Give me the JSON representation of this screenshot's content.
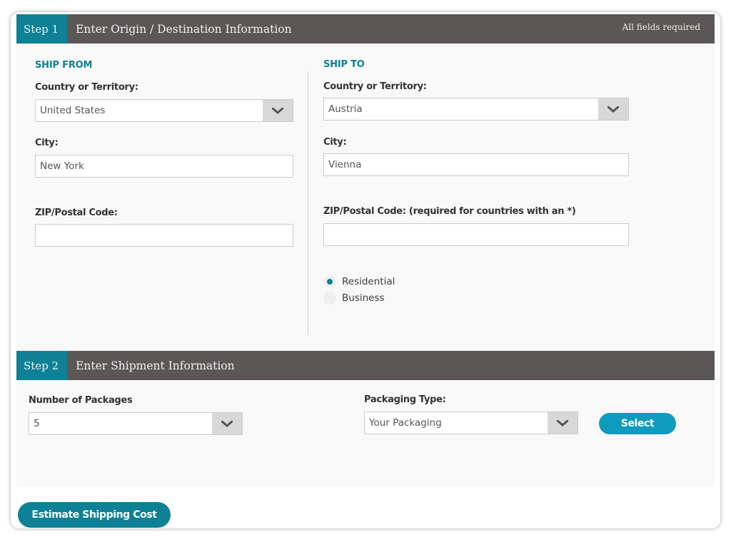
{
  "step1": {
    "tag": "Step 1",
    "title": "Enter Origin / Destination Information",
    "note": "All fields required",
    "ship_from": {
      "title": "SHIP FROM",
      "country_label": "Country or Territory:",
      "country_value": "United States",
      "city_label": "City:",
      "city_value": "New York",
      "zip_label": "ZIP/Postal Code:",
      "zip_value": ""
    },
    "ship_to": {
      "title": "SHIP TO",
      "country_label": "Country or Territory:",
      "country_value": "Austria",
      "city_label": "City:",
      "city_value": "Vienna",
      "zip_label": "ZIP/Postal Code: (required for countries with an *)",
      "zip_value": "",
      "address_type": {
        "options": [
          "Residential",
          "Business"
        ],
        "selected": "Residential"
      }
    }
  },
  "step2": {
    "tag": "Step 2",
    "title": "Enter Shipment Information",
    "packages_label": "Number of Packages",
    "packages_value": "5",
    "packaging_label": "Packaging Type:",
    "packaging_value": "Your Packaging",
    "select_button": "Select"
  },
  "actions": {
    "estimate_button": "Estimate Shipping Cost"
  },
  "colors": {
    "accent": "#0e8196",
    "header_bg": "#5b5756",
    "select_button": "#0f9bbd"
  }
}
